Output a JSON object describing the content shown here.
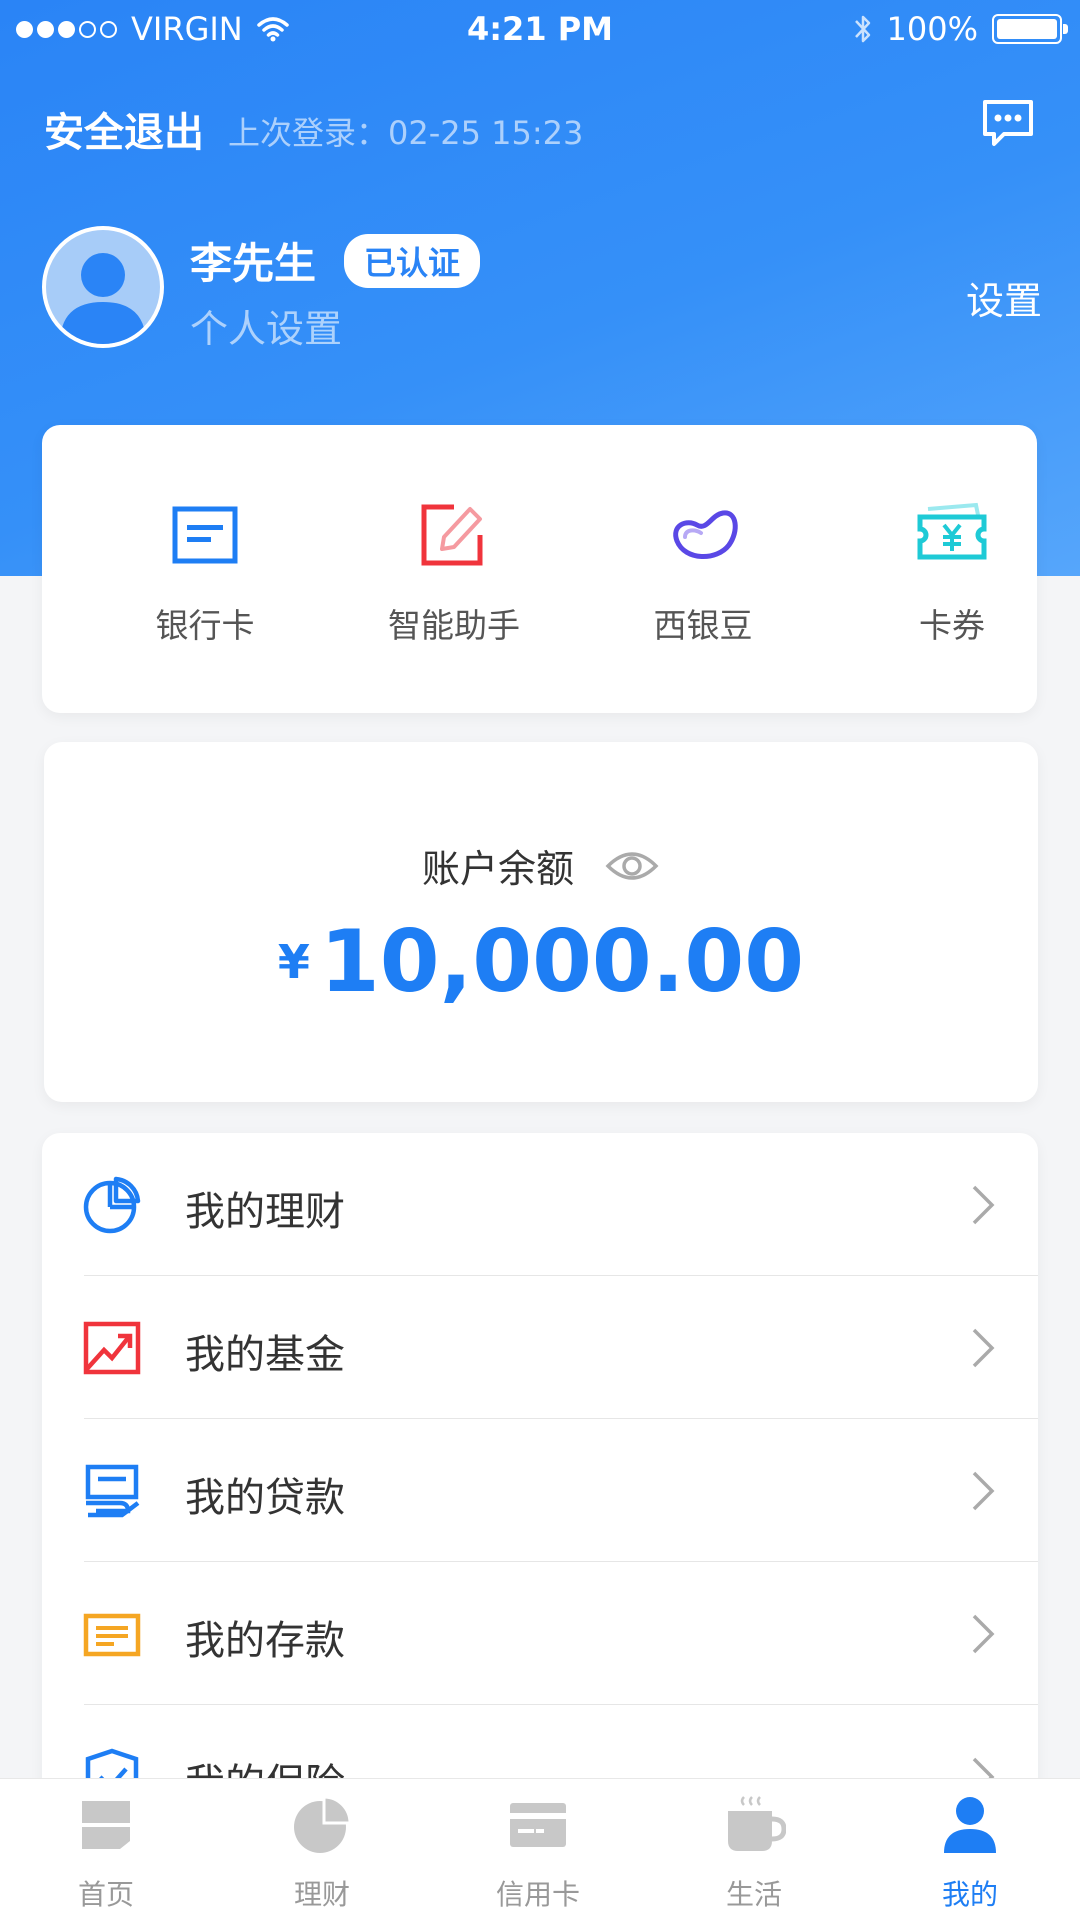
{
  "status_bar": {
    "carrier": "VIRGIN",
    "time": "4:21 PM",
    "battery": "100%"
  },
  "header": {
    "logout": "安全退出",
    "last_login": "上次登录：02-25 15:23",
    "settings": "设置"
  },
  "profile": {
    "name": "李先生",
    "badge": "已认证",
    "subtitle": "个人设置"
  },
  "quick_actions": [
    {
      "label": "银行卡",
      "icon": "bank-card-icon",
      "color": "#1e7ef4"
    },
    {
      "label": "智能助手",
      "icon": "edit-icon",
      "color": "#f0343c"
    },
    {
      "label": "西银豆",
      "icon": "bean-icon",
      "color": "#5a48e6"
    },
    {
      "label": "卡券",
      "icon": "coupon-icon",
      "color": "#1ecad6"
    }
  ],
  "balance": {
    "title": "账户余额",
    "currency": "¥",
    "amount": "10,000.00"
  },
  "menu": [
    {
      "label": "我的理财",
      "icon": "pie-chart-icon",
      "color": "#1e7ef4"
    },
    {
      "label": "我的基金",
      "icon": "trend-chart-icon",
      "color": "#f0343c"
    },
    {
      "label": "我的贷款",
      "icon": "loan-icon",
      "color": "#1e7ef4"
    },
    {
      "label": "我的存款",
      "icon": "deposit-icon",
      "color": "#f5a623"
    },
    {
      "label": "我的保险",
      "icon": "shield-icon",
      "color": "#1e7ef4"
    }
  ],
  "tabs": [
    {
      "label": "首页",
      "icon": "home-icon"
    },
    {
      "label": "理财",
      "icon": "pie-chart-icon"
    },
    {
      "label": "信用卡",
      "icon": "credit-card-icon"
    },
    {
      "label": "生活",
      "icon": "coffee-cup-icon"
    },
    {
      "label": "我的",
      "icon": "user-icon",
      "active": true
    }
  ],
  "colors": {
    "primary": "#1e7ef4",
    "header_gradient_start": "#2a84f6",
    "header_gradient_end": "#56a6fb",
    "background": "#f4f5f7"
  }
}
